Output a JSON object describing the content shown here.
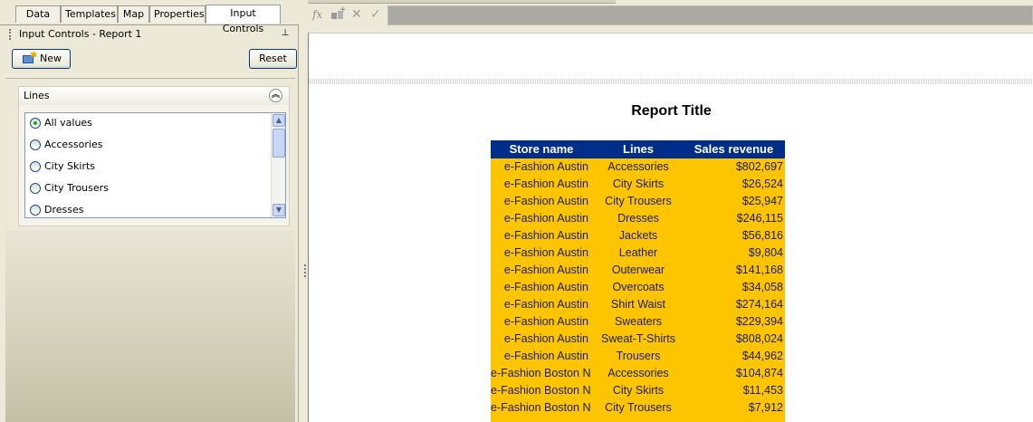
{
  "tabs": [
    "Data",
    "Templates",
    "Map",
    "Properties",
    "Input Controls"
  ],
  "panel": {
    "title": "Input Controls - Report 1",
    "new_label": "New",
    "reset_label": "Reset"
  },
  "lines_control": {
    "label": "Lines",
    "options": [
      {
        "label": "All values",
        "selected": true
      },
      {
        "label": "Accessories",
        "selected": false
      },
      {
        "label": "City Skirts",
        "selected": false
      },
      {
        "label": "City Trousers",
        "selected": false
      },
      {
        "label": "Dresses",
        "selected": false
      }
    ]
  },
  "formula_bar": {
    "fx": "fx"
  },
  "report": {
    "title": "Report Title",
    "columns": [
      "Store name",
      "Lines",
      "Sales revenue"
    ],
    "rows": [
      [
        "e-Fashion Austin",
        "Accessories",
        "$802,697"
      ],
      [
        "e-Fashion Austin",
        "City Skirts",
        "$26,524"
      ],
      [
        "e-Fashion Austin",
        "City Trousers",
        "$25,947"
      ],
      [
        "e-Fashion Austin",
        "Dresses",
        "$246,115"
      ],
      [
        "e-Fashion Austin",
        "Jackets",
        "$56,816"
      ],
      [
        "e-Fashion Austin",
        "Leather",
        "$9,804"
      ],
      [
        "e-Fashion Austin",
        "Outerwear",
        "$141,168"
      ],
      [
        "e-Fashion Austin",
        "Overcoats",
        "$34,058"
      ],
      [
        "e-Fashion Austin",
        "Shirt Waist",
        "$274,164"
      ],
      [
        "e-Fashion Austin",
        "Sweaters",
        "$229,394"
      ],
      [
        "e-Fashion Austin",
        "Sweat-T-Shirts",
        "$808,024"
      ],
      [
        "e-Fashion Austin",
        "Trousers",
        "$44,962"
      ],
      [
        "e-Fashion Boston Newbury",
        "Accessories",
        "$104,874"
      ],
      [
        "e-Fashion Boston Newbury",
        "City Skirts",
        "$11,453"
      ],
      [
        "e-Fashion Boston Newbury",
        "City Trousers",
        "$7,912"
      ]
    ]
  },
  "colors": {
    "header_bg": "#002c8a",
    "row_bg": "#fdc500"
  }
}
